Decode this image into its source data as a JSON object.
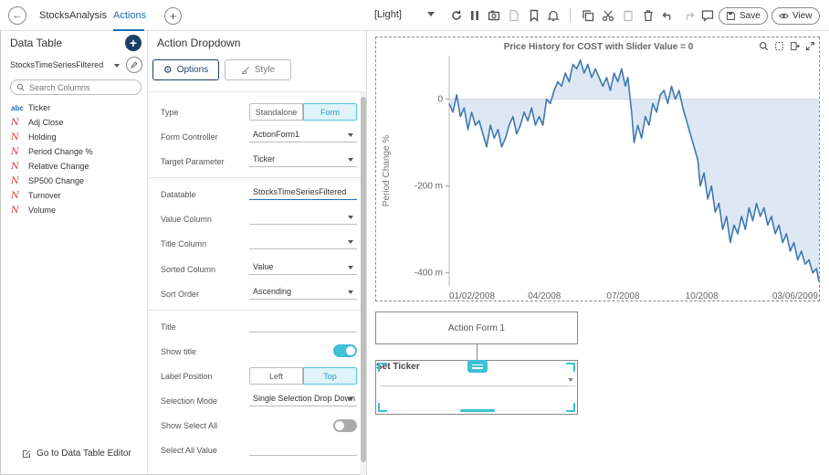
{
  "app": {
    "tabs": [
      {
        "label": "StocksAnalysis",
        "active": false
      },
      {
        "label": "Actions",
        "active": true
      }
    ],
    "theme": "[Light]",
    "save_label": "Save",
    "view_label": "View"
  },
  "left_panel": {
    "title": "Data Table",
    "datasource": "StocksTimeSeriesFiltered",
    "search_placeholder": "Search Columns",
    "columns": [
      {
        "type": "abc",
        "name": "Ticker"
      },
      {
        "type": "num",
        "name": "Adj Close"
      },
      {
        "type": "num",
        "name": "Holding"
      },
      {
        "type": "num",
        "name": "Period Change %"
      },
      {
        "type": "num",
        "name": "Relative Change"
      },
      {
        "type": "num",
        "name": "SP500 Change"
      },
      {
        "type": "num",
        "name": "Turnover"
      },
      {
        "type": "num",
        "name": "Volume"
      }
    ],
    "editor_link": "Go to Data Table Editor"
  },
  "mid_panel": {
    "title": "Action Dropdown",
    "options_label": "Options",
    "style_label": "Style",
    "type": {
      "label": "Type",
      "opt_a": "Standalone",
      "opt_b": "Form",
      "selected": "Form"
    },
    "form_controller": {
      "label": "Form Controller",
      "value": "ActionForm1"
    },
    "target_parameter": {
      "label": "Target Parameter",
      "value": "Ticker"
    },
    "datatable": {
      "label": "Datatable",
      "value": "StocksTimeSeriesFiltered"
    },
    "value_column": {
      "label": "Value Column",
      "value": ""
    },
    "title_column": {
      "label": "Title Column",
      "value": ""
    },
    "sorted_column": {
      "label": "Sorted Column",
      "value": "Value"
    },
    "sort_order": {
      "label": "Sort Order",
      "value": "Ascending"
    },
    "title_field": {
      "label": "Title",
      "value": ""
    },
    "show_title": {
      "label": "Show title",
      "on": true
    },
    "label_position": {
      "label": "Label Position",
      "opt_a": "Left",
      "opt_b": "Top",
      "selected": "Top"
    },
    "selection_mode": {
      "label": "Selection Mode",
      "value": "Single Selection Drop Down"
    },
    "show_select_all": {
      "label": "Show Select All",
      "on": false
    },
    "select_all_value": {
      "label": "Select All Value",
      "value": ""
    }
  },
  "canvas": {
    "form_label": "Action Form 1",
    "dropdown_label": "Set Ticker"
  },
  "colors": {
    "accent": "#1e6fb5",
    "teal": "#3ec0d6",
    "line": "#3f78b0",
    "area": "#dde8f4"
  },
  "chart_data": {
    "type": "area",
    "title": "Price History for COST with Slider Value = 0",
    "ylabel": "Period Change %",
    "y_ticks": [
      "0",
      "-200 m",
      "-400 m"
    ],
    "y_tick_values": [
      0,
      -0.2,
      -0.4
    ],
    "ylim": [
      -0.43,
      0.1
    ],
    "x_ticks": [
      "01/02/2008",
      "04/2008",
      "07/2008",
      "10/2008",
      "03/06/2009"
    ],
    "x_tick_values": [
      0,
      63,
      126,
      189,
      294
    ],
    "xlim": [
      0,
      296
    ],
    "baseline": 0,
    "series": [
      {
        "values": [
          [
            0,
            -0.01
          ],
          [
            3,
            -0.03
          ],
          [
            6,
            0.01
          ],
          [
            9,
            -0.04
          ],
          [
            12,
            -0.02
          ],
          [
            15,
            -0.07
          ],
          [
            18,
            -0.03
          ],
          [
            21,
            -0.06
          ],
          [
            24,
            -0.05
          ],
          [
            27,
            -0.08
          ],
          [
            30,
            -0.11
          ],
          [
            33,
            -0.06
          ],
          [
            36,
            -0.09
          ],
          [
            39,
            -0.07
          ],
          [
            42,
            -0.11
          ],
          [
            45,
            -0.09
          ],
          [
            48,
            -0.06
          ],
          [
            51,
            -0.04
          ],
          [
            54,
            -0.08
          ],
          [
            57,
            -0.06
          ],
          [
            60,
            -0.03
          ],
          [
            63,
            -0.05
          ],
          [
            66,
            -0.02
          ],
          [
            69,
            -0.06
          ],
          [
            72,
            -0.04
          ],
          [
            75,
            -0.06
          ],
          [
            78,
            0.0
          ],
          [
            81,
            -0.01
          ],
          [
            84,
            0.02
          ],
          [
            87,
            0.04
          ],
          [
            90,
            0.03
          ],
          [
            93,
            0.06
          ],
          [
            96,
            0.04
          ],
          [
            99,
            0.08
          ],
          [
            102,
            0.07
          ],
          [
            105,
            0.09
          ],
          [
            108,
            0.06
          ],
          [
            111,
            0.08
          ],
          [
            114,
            0.05
          ],
          [
            117,
            0.07
          ],
          [
            120,
            0.05
          ],
          [
            123,
            0.03
          ],
          [
            126,
            0.05
          ],
          [
            129,
            0.02
          ],
          [
            132,
            0.06
          ],
          [
            135,
            0.04
          ],
          [
            138,
            0.07
          ],
          [
            141,
            0.03
          ],
          [
            143,
            0.05
          ],
          [
            146,
            -0.03
          ],
          [
            148,
            -0.1
          ],
          [
            151,
            -0.06
          ],
          [
            154,
            -0.09
          ],
          [
            157,
            -0.04
          ],
          [
            160,
            -0.06
          ],
          [
            163,
            -0.01
          ],
          [
            166,
            -0.03
          ],
          [
            169,
            0.01
          ],
          [
            172,
            0.02
          ],
          [
            175,
            -0.01
          ],
          [
            178,
            0.03
          ],
          [
            181,
            0.0
          ],
          [
            184,
            0.02
          ],
          [
            187,
            -0.02
          ],
          [
            190,
            -0.05
          ],
          [
            193,
            -0.08
          ],
          [
            196,
            -0.11
          ],
          [
            199,
            -0.14
          ],
          [
            201,
            -0.2
          ],
          [
            204,
            -0.17
          ],
          [
            207,
            -0.23
          ],
          [
            210,
            -0.2
          ],
          [
            213,
            -0.26
          ],
          [
            216,
            -0.24
          ],
          [
            219,
            -0.3
          ],
          [
            222,
            -0.27
          ],
          [
            225,
            -0.33
          ],
          [
            228,
            -0.29
          ],
          [
            231,
            -0.31
          ],
          [
            234,
            -0.27
          ],
          [
            237,
            -0.3
          ],
          [
            240,
            -0.25
          ],
          [
            243,
            -0.28
          ],
          [
            246,
            -0.24
          ],
          [
            249,
            -0.27
          ],
          [
            252,
            -0.25
          ],
          [
            255,
            -0.29
          ],
          [
            258,
            -0.27
          ],
          [
            261,
            -0.31
          ],
          [
            264,
            -0.29
          ],
          [
            267,
            -0.33
          ],
          [
            270,
            -0.31
          ],
          [
            273,
            -0.35
          ],
          [
            276,
            -0.33
          ],
          [
            279,
            -0.37
          ],
          [
            282,
            -0.35
          ],
          [
            285,
            -0.38
          ],
          [
            288,
            -0.37
          ],
          [
            291,
            -0.4
          ],
          [
            294,
            -0.39
          ],
          [
            296,
            -0.42
          ]
        ]
      }
    ]
  }
}
